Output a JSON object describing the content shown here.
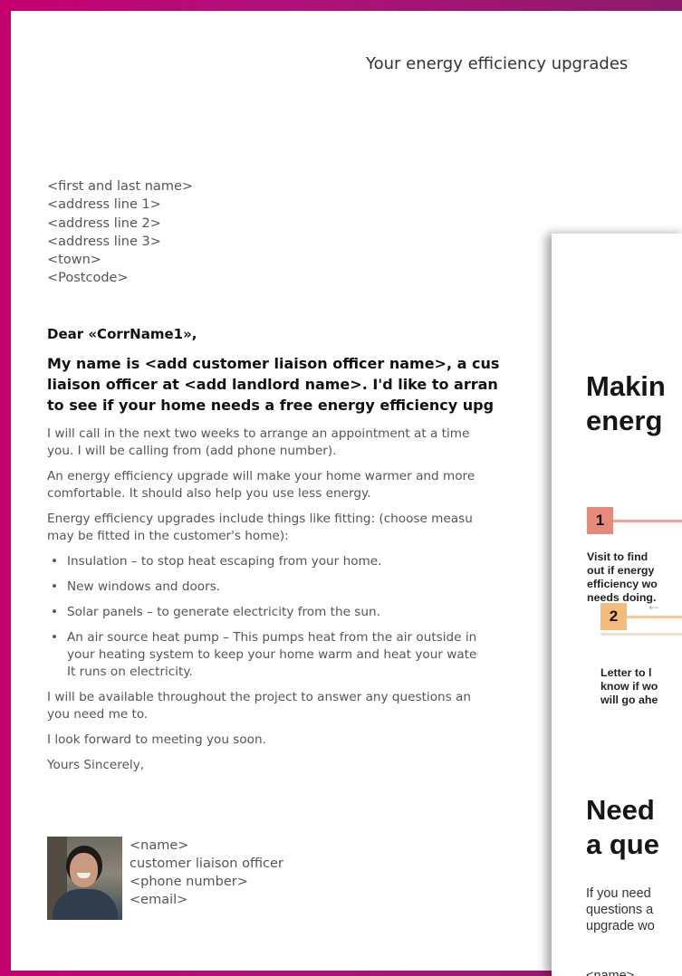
{
  "letter": {
    "header_title": "Your energy efficiency upgrades",
    "address": [
      "<first and last name>",
      "<address line 1>",
      "<address line 2>",
      "<address line 3>",
      "<town>",
      "<Postcode>"
    ],
    "salutation": "Dear «CorrName1»,",
    "intro": [
      "My name is <add customer liaison officer name>, a cus",
      "liaison officer at <add landlord name>. I'd like to arran",
      "to see if your home needs a free energy efficiency upg"
    ],
    "paragraphs": [
      "I will call in the next two weeks to arrange an appointment at a time\nyou. I will be calling from (add phone number).",
      "An energy efficiency upgrade will make your home warmer and more\ncomfortable. It should also help you use less energy.",
      "Energy efficiency upgrades include things like fitting: (choose measu\nmay be fitted in the customer's home):"
    ],
    "bullets": [
      "Insulation – to stop heat escaping from your home.",
      "New windows and doors.",
      "Solar panels – to generate electricity from the sun.",
      "An air source heat pump – This pumps heat from the air outside in\nyour heating system to keep your home warm and heat your wate\nIt runs on electricity."
    ],
    "closing_paragraphs": [
      "I will be available throughout the project to answer any questions an\nyou need me to.",
      "I look forward to meeting you soon.",
      "Yours Sincerely,"
    ],
    "signature": {
      "name": "<name>",
      "role": "customer liaison officer",
      "phone": "<phone number>",
      "email": "<email>"
    }
  },
  "leaflet": {
    "title": [
      "Makin",
      "energ"
    ],
    "steps": [
      {
        "number": "1",
        "text": "Visit to find\nout if energy\nefficiency wo\nneeds doing."
      },
      {
        "number": "2",
        "text": "Letter to l\nknow if wo\nwill go ahe"
      }
    ],
    "need_title": [
      "Need",
      "a que"
    ],
    "need_text": "If you need\nquestions a\nupgrade wo",
    "contact_name": "<name>",
    "colors": {
      "step1": "#e58a7c",
      "step2": "#f3bb7c"
    }
  }
}
